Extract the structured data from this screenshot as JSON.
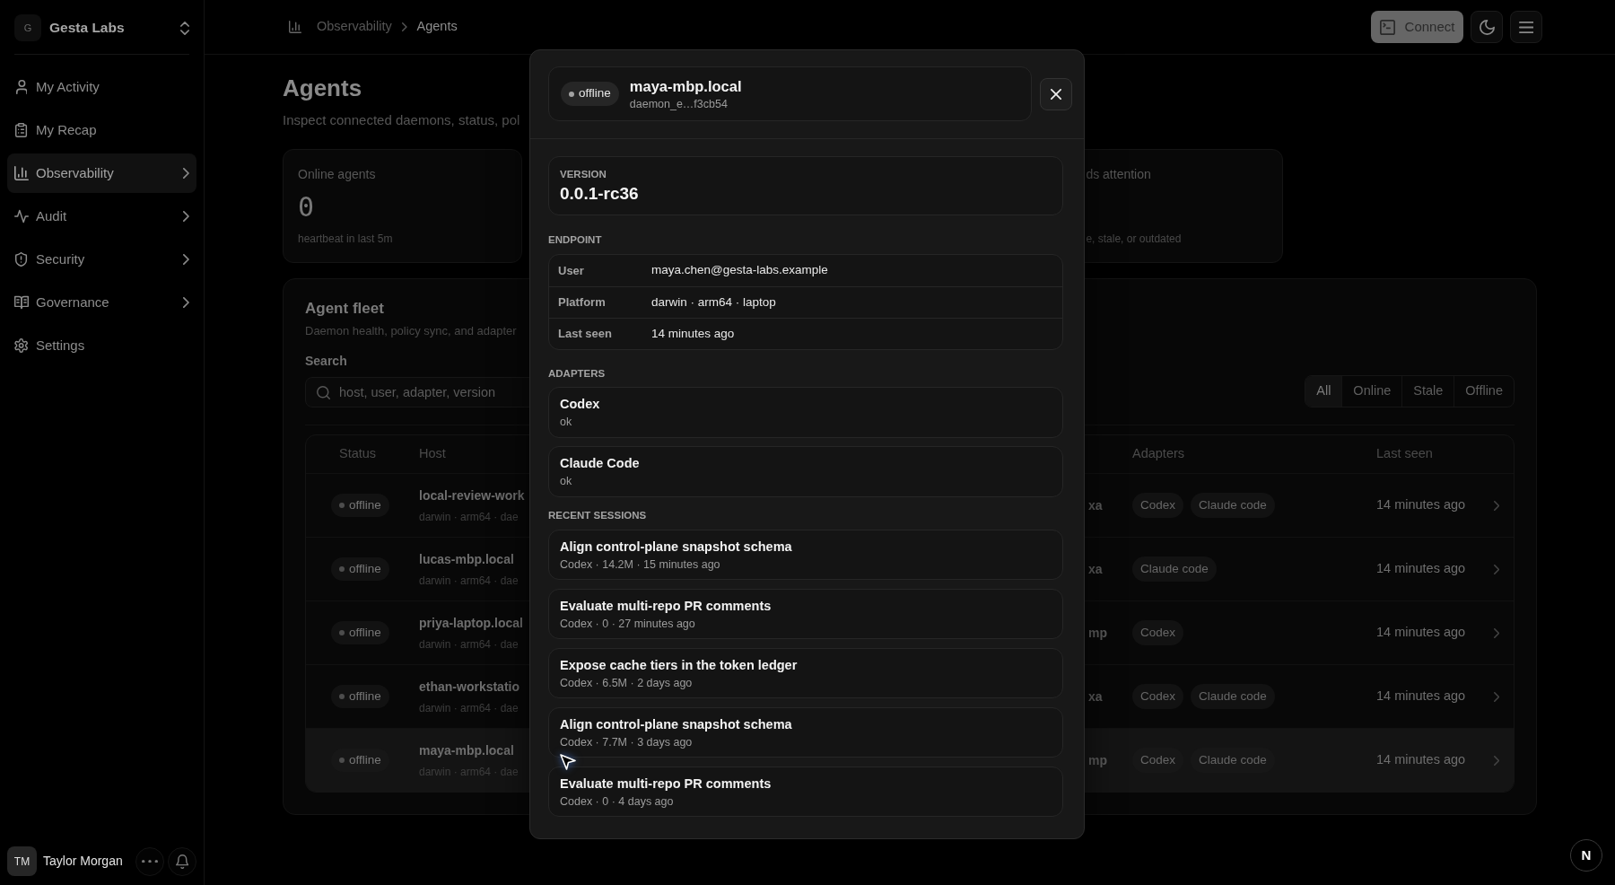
{
  "sidebar": {
    "org": {
      "initial": "G",
      "name": "Gesta Labs"
    },
    "items": [
      {
        "label": "My Activity",
        "selected": false,
        "expandable": false
      },
      {
        "label": "My Recap",
        "selected": false,
        "expandable": false
      },
      {
        "label": "Observability",
        "selected": true,
        "expandable": true
      },
      {
        "label": "Audit",
        "selected": false,
        "expandable": true
      },
      {
        "label": "Security",
        "selected": false,
        "expandable": true
      },
      {
        "label": "Governance",
        "selected": false,
        "expandable": true
      },
      {
        "label": "Settings",
        "selected": false,
        "expandable": false
      }
    ],
    "user": {
      "initials": "TM",
      "name": "Taylor Morgan"
    }
  },
  "topbar": {
    "breadcrumb": [
      "Observability",
      "Agents"
    ],
    "connect_button": "Connect"
  },
  "page": {
    "title": "Agents",
    "subtitle": "Inspect connected daemons, status, pol"
  },
  "stats": [
    {
      "label": "Online agents",
      "value": "0",
      "caption": "heartbeat in last 5m"
    },
    {
      "label": "ds attention",
      "caption": "e, stale, or outdated"
    }
  ],
  "fleet": {
    "title": "Agent fleet",
    "description": "Daemon health, policy sync, and adapter",
    "search": {
      "label": "Search",
      "placeholder": "host, user, adapter, version"
    },
    "filters": [
      {
        "label": "All",
        "selected": true
      },
      {
        "label": "Online",
        "selected": false
      },
      {
        "label": "Stale",
        "selected": false
      },
      {
        "label": "Offline",
        "selected": false
      }
    ],
    "table": {
      "columns": [
        "Status",
        "Host",
        "Adapters",
        "Last seen"
      ],
      "rows": [
        {
          "status": "offline",
          "host": "local-review-work",
          "details": "darwin · arm64 · dae",
          "column_3": "xa",
          "adapters": [
            "Codex",
            "Claude code"
          ],
          "last_seen": "14 minutes ago",
          "selected": false
        },
        {
          "status": "offline",
          "host": "lucas-mbp.local",
          "details": "darwin · arm64 · dae",
          "column_3": "xa",
          "adapters": [
            "Claude code"
          ],
          "last_seen": "14 minutes ago",
          "selected": false
        },
        {
          "status": "offline",
          "host": "priya-laptop.local",
          "details": "darwin · arm64 · dae",
          "column_3": "mp",
          "adapters": [
            "Codex"
          ],
          "last_seen": "14 minutes ago",
          "selected": false
        },
        {
          "status": "offline",
          "host": "ethan-workstatio",
          "details": "darwin · arm64 · dae",
          "column_3": "xa",
          "adapters": [
            "Codex",
            "Claude code"
          ],
          "last_seen": "14 minutes ago",
          "selected": false
        },
        {
          "status": "offline",
          "host": "maya-mbp.local",
          "details": "darwin · arm64 · dae",
          "column_3": "mp",
          "adapters": [
            "Codex",
            "Claude code"
          ],
          "last_seen": "14 minutes ago",
          "selected": true
        }
      ]
    }
  },
  "dialog": {
    "status": "offline",
    "title": "maya-mbp.local",
    "subtitle": "daemon_e…f3cb54",
    "version": {
      "label": "VERSION",
      "value": "0.0.1-rc36"
    },
    "endpoint": {
      "heading": "ENDPOINT",
      "rows": [
        {
          "label": "User",
          "value": "maya.chen@gesta-labs.example"
        },
        {
          "label": "Platform",
          "value": "darwin · arm64 · laptop"
        },
        {
          "label": "Last seen",
          "value": "14 minutes ago"
        }
      ]
    },
    "adapters": {
      "heading": "ADAPTERS",
      "items": [
        {
          "name": "Codex",
          "status": "ok"
        },
        {
          "name": "Claude Code",
          "status": "ok"
        }
      ]
    },
    "sessions": {
      "heading": "RECENT SESSIONS",
      "items": [
        {
          "title": "Align control-plane snapshot schema",
          "meta": "Codex · 14.2M · 15 minutes ago"
        },
        {
          "title": "Evaluate multi-repo PR comments",
          "meta": "Codex · 0 · 27 minutes ago"
        },
        {
          "title": "Expose cache tiers in the token ledger",
          "meta": "Codex · 6.5M · 2 days ago"
        },
        {
          "title": "Align control-plane snapshot schema",
          "meta": "Codex · 7.7M · 3 days ago"
        },
        {
          "title": "Evaluate multi-repo PR comments",
          "meta": "Codex · 0 · 4 days ago"
        }
      ]
    }
  },
  "dev_indicator": "N"
}
